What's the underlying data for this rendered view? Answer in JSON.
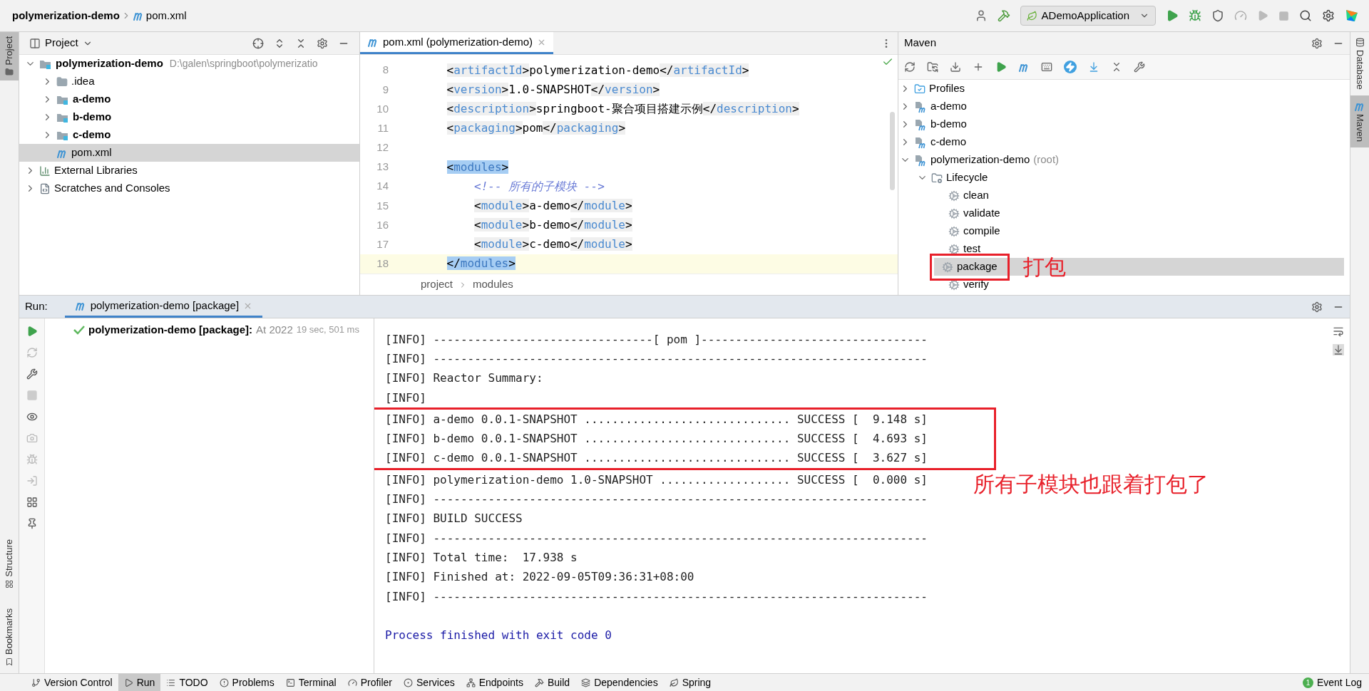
{
  "breadcrumb": [
    "polymerization-demo",
    "pom.xml"
  ],
  "run_configuration": "ADemoApplication",
  "left_stripe": {
    "top": [
      {
        "label": "Project",
        "selected": true
      }
    ],
    "bottom": [
      {
        "label": "Structure",
        "selected": false
      },
      {
        "label": "Bookmarks",
        "selected": false
      }
    ]
  },
  "right_stripe": [
    {
      "label": "Database",
      "kind": "database",
      "selected": false
    },
    {
      "label": "Maven",
      "kind": "maven",
      "selected": true
    }
  ],
  "project_panel": {
    "title": "Project",
    "tree": [
      {
        "label": "polymerization-demo",
        "path": "D:\\galen\\springboot\\polymerizatio",
        "kind": "module",
        "bold": true,
        "expanded": true,
        "selected": false,
        "children": [
          {
            "label": ".idea",
            "kind": "folder",
            "bold": false,
            "expanded": false,
            "selected": false
          },
          {
            "label": "a-demo",
            "kind": "module",
            "bold": true,
            "expanded": false,
            "selected": false
          },
          {
            "label": "b-demo",
            "kind": "module",
            "bold": true,
            "expanded": false,
            "selected": false
          },
          {
            "label": "c-demo",
            "kind": "module",
            "bold": true,
            "expanded": false,
            "selected": false
          },
          {
            "label": "pom.xml",
            "kind": "pom",
            "bold": false,
            "selected": true
          }
        ]
      },
      {
        "label": "External Libraries",
        "kind": "library",
        "bold": false,
        "expanded": false,
        "selected": false
      },
      {
        "label": "Scratches and Consoles",
        "kind": "scratches",
        "bold": false,
        "expanded": false,
        "selected": false
      }
    ]
  },
  "editor": {
    "tab": {
      "label": "pom.xml (polymerization-demo)",
      "selected": true
    },
    "lines": [
      {
        "number": "8",
        "text": "    <artifactId>polymerization-demo</artifactId>",
        "kind": "xml",
        "highlighted": false,
        "current": false
      },
      {
        "number": "9",
        "text": "    <version>1.0-SNAPSHOT</version>",
        "kind": "xml",
        "highlighted": false,
        "current": false
      },
      {
        "number": "10",
        "text": "    <description>springboot-聚合项目搭建示例</description>",
        "kind": "xml",
        "highlighted": false,
        "current": false
      },
      {
        "number": "11",
        "text": "    <packaging>pom</packaging>",
        "kind": "xml",
        "highlighted": false,
        "current": false
      },
      {
        "number": "12",
        "kind": "blank",
        "current": false
      },
      {
        "number": "13",
        "text": "    <modules>",
        "kind": "xml",
        "highlighted": true,
        "current": false
      },
      {
        "number": "14",
        "text": "        <!-- 所有的子模块 -->",
        "kind": "comment",
        "highlighted": false,
        "current": false
      },
      {
        "number": "15",
        "text": "        <module>a-demo</module>",
        "kind": "xml",
        "highlighted": false,
        "current": false
      },
      {
        "number": "16",
        "text": "        <module>b-demo</module>",
        "kind": "xml",
        "highlighted": false,
        "current": false
      },
      {
        "number": "17",
        "text": "        <module>c-demo</module>",
        "kind": "xml",
        "highlighted": false,
        "current": false
      },
      {
        "number": "18",
        "text": "    </modules>",
        "kind": "xml",
        "highlighted": true,
        "current": true
      }
    ],
    "breadcrumb": [
      "project",
      "modules"
    ]
  },
  "maven_panel": {
    "title": "Maven",
    "tree": [
      {
        "label": "Profiles",
        "kind": "profiles",
        "expanded": false,
        "selected": false
      },
      {
        "label": "a-demo",
        "kind": "project",
        "expanded": false,
        "selected": false
      },
      {
        "label": "b-demo",
        "kind": "project",
        "expanded": false,
        "selected": false
      },
      {
        "label": "c-demo",
        "kind": "project",
        "expanded": false,
        "selected": false
      },
      {
        "label": "polymerization-demo",
        "suffix": "(root)",
        "kind": "project",
        "expanded": true,
        "selected": false,
        "children": [
          {
            "label": "Lifecycle",
            "kind": "lifecycle",
            "expanded": true,
            "selected": false,
            "children": [
              {
                "label": "clean",
                "kind": "goal",
                "selected": false
              },
              {
                "label": "validate",
                "kind": "goal",
                "selected": false
              },
              {
                "label": "compile",
                "kind": "goal",
                "selected": false
              },
              {
                "label": "test",
                "kind": "goal",
                "selected": false
              },
              {
                "label": "package",
                "kind": "goal",
                "selected": true,
                "boxed": true,
                "note": "打包"
              },
              {
                "label": "verify",
                "kind": "goal",
                "selected": false
              }
            ]
          }
        ]
      }
    ]
  },
  "run_panel": {
    "title": "Run:",
    "tabs": [
      {
        "label": "polymerization-demo [package]",
        "selected": true
      }
    ],
    "tree": [
      {
        "label": "polymerization-demo [package]:",
        "succeeded": true,
        "time": "At 2022",
        "duration": "19 sec, 501 ms"
      }
    ],
    "console": {
      "note": "所有子模块也跟着打包了",
      "lines": [
        {
          "text": "[INFO] --------------------------------[ pom ]---------------------------------",
          "kind": "info",
          "boxed": false
        },
        {
          "text": "[INFO] ------------------------------------------------------------------------",
          "kind": "info",
          "boxed": false
        },
        {
          "text": "[INFO] Reactor Summary:",
          "kind": "info",
          "boxed": false
        },
        {
          "text": "[INFO]",
          "kind": "info",
          "boxed": false
        },
        {
          "text": "[INFO] a-demo 0.0.1-SNAPSHOT .............................. SUCCESS [  9.148 s]",
          "kind": "info",
          "boxed": true
        },
        {
          "text": "[INFO] b-demo 0.0.1-SNAPSHOT .............................. SUCCESS [  4.693 s]",
          "kind": "info",
          "boxed": true
        },
        {
          "text": "[INFO] c-demo 0.0.1-SNAPSHOT .............................. SUCCESS [  3.627 s]",
          "kind": "info",
          "boxed": true
        },
        {
          "text": "[INFO] polymerization-demo 1.0-SNAPSHOT ................... SUCCESS [  0.000 s]",
          "kind": "info",
          "boxed": false
        },
        {
          "text": "[INFO] ------------------------------------------------------------------------",
          "kind": "info",
          "boxed": false
        },
        {
          "text": "[INFO] BUILD SUCCESS",
          "kind": "info",
          "boxed": false
        },
        {
          "text": "[INFO] ------------------------------------------------------------------------",
          "kind": "info",
          "boxed": false
        },
        {
          "text": "[INFO] Total time:  17.938 s",
          "kind": "info",
          "boxed": false
        },
        {
          "text": "[INFO] Finished at: 2022-09-05T09:36:31+08:00",
          "kind": "info",
          "boxed": false
        },
        {
          "text": "[INFO] ------------------------------------------------------------------------",
          "kind": "info",
          "boxed": false
        },
        {
          "text": "Process finished with exit code 0",
          "kind": "process",
          "boxed": false
        }
      ]
    }
  },
  "status_bar": {
    "tools": [
      {
        "label": "Version Control",
        "kind": "vcs",
        "selected": false
      },
      {
        "label": "Run",
        "kind": "run",
        "selected": true
      },
      {
        "label": "TODO",
        "kind": "todo",
        "selected": false
      },
      {
        "label": "Problems",
        "kind": "problems",
        "selected": false
      },
      {
        "label": "Terminal",
        "kind": "terminal",
        "selected": false
      },
      {
        "label": "Profiler",
        "kind": "profiler",
        "selected": false
      },
      {
        "label": "Services",
        "kind": "services",
        "selected": false
      },
      {
        "label": "Endpoints",
        "kind": "endpoints",
        "selected": false
      },
      {
        "label": "Build",
        "kind": "build",
        "selected": false
      },
      {
        "label": "Dependencies",
        "kind": "dependencies",
        "selected": false
      },
      {
        "label": "Spring",
        "kind": "spring",
        "selected": false
      }
    ],
    "event_log": {
      "label": "Event Log",
      "count": "1"
    }
  }
}
